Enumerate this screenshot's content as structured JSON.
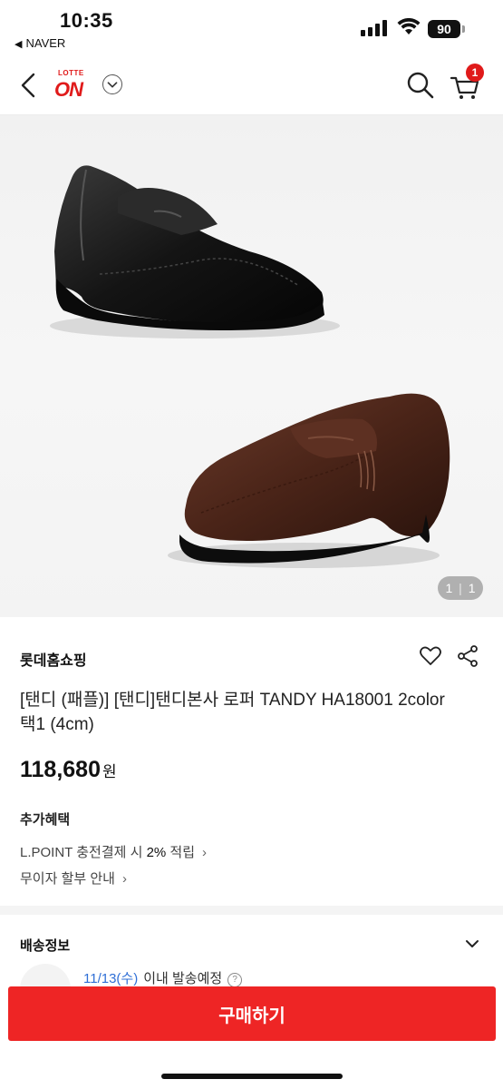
{
  "status": {
    "time": "10:35",
    "back_app": "NAVER",
    "battery": "90"
  },
  "nav": {
    "logo_top": "LOTTE",
    "logo_main": "ON",
    "cart_count": "1",
    "accent": "#e01a1a"
  },
  "gallery": {
    "counter_current": "1",
    "counter_total": "1"
  },
  "product": {
    "seller": "롯데홈쇼핑",
    "title": "[탠디 (패플)] [탠디]탠디본사 로퍼 TANDY HA18001 2color 택1 (4cm)",
    "price": "118,680",
    "price_unit": "원"
  },
  "benefits": {
    "title": "추가혜택",
    "items": [
      {
        "prefix": "L.POINT 충전결제 시 ",
        "highlight": "2%",
        "suffix": " 적립"
      },
      {
        "prefix": "무이자 할부 안내",
        "highlight": "",
        "suffix": ""
      }
    ]
  },
  "shipping": {
    "title": "배송정보",
    "date": "11/13(수)",
    "text": "이내 발송예정"
  },
  "buy": {
    "label": "구매하기",
    "color": "#ee2525"
  }
}
